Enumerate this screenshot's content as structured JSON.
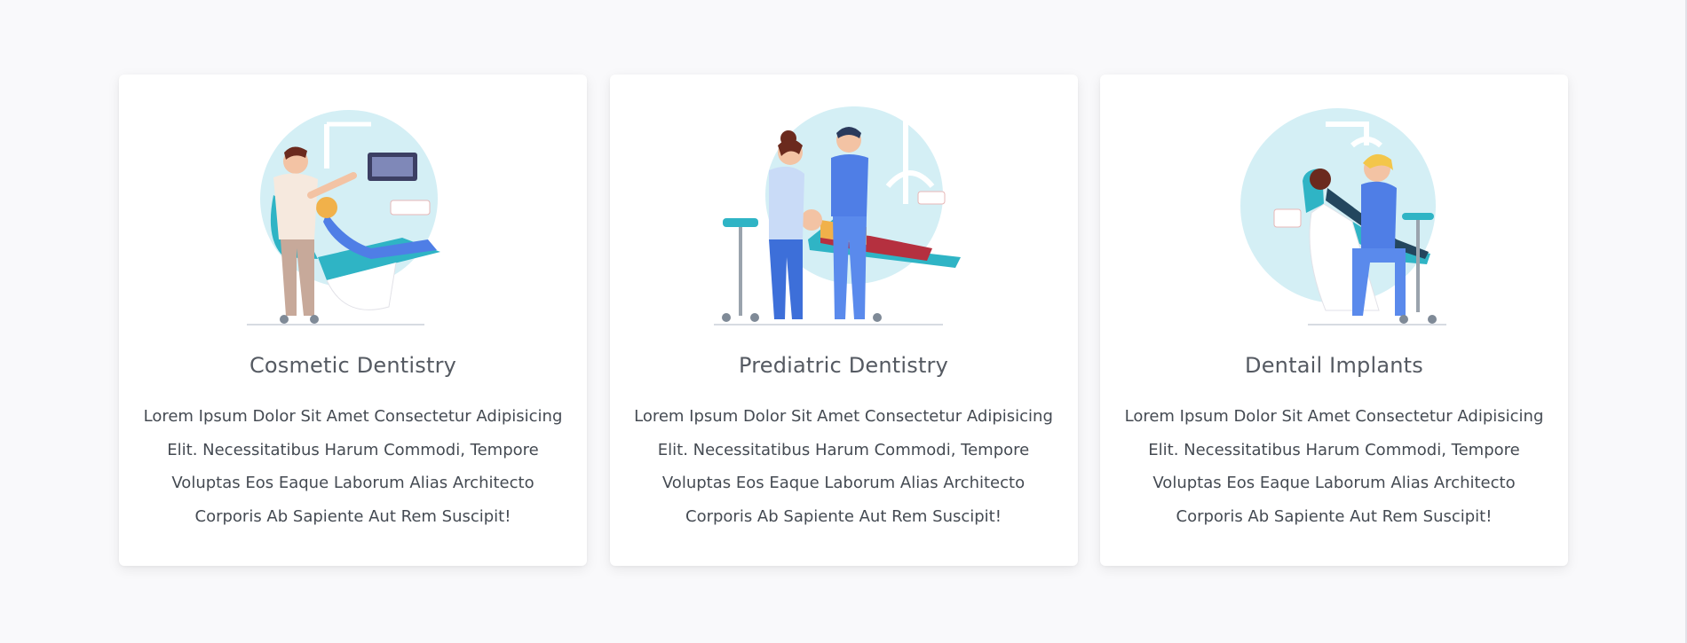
{
  "services": [
    {
      "title": "Cosmetic Dentistry",
      "text": "Lorem Ipsum Dolor Sit Amet Consectetur Adipisicing Elit. Necessitatibus Harum Commodi, Tempore Voluptas Eos Eaque Laborum Alias Architecto Corporis Ab Sapiente Aut Rem Suscipit!",
      "illustration": "dentist-with-patient-illustration"
    },
    {
      "title": "Prediatric Dentistry",
      "text": "Lorem Ipsum Dolor Sit Amet Consectetur Adipisicing Elit. Necessitatibus Harum Commodi, Tempore Voluptas Eos Eaque Laborum Alias Architecto Corporis Ab Sapiente Aut Rem Suscipit!",
      "illustration": "two-dentists-with-child-illustration"
    },
    {
      "title": "Dentail Implants",
      "text": "Lorem Ipsum Dolor Sit Amet Consectetur Adipisicing Elit. Necessitatibus Harum Commodi, Tempore Voluptas Eos Eaque Laborum Alias Architecto Corporis Ab Sapiente Aut Rem Suscipit!",
      "illustration": "implant-procedure-illustration"
    }
  ],
  "colors": {
    "accent_teal": "#2fb4c5",
    "circle_light": "#d4eff5",
    "scrub_blue": "#4f7ee6",
    "title_gray": "#555a62",
    "text_gray": "#444a52"
  }
}
